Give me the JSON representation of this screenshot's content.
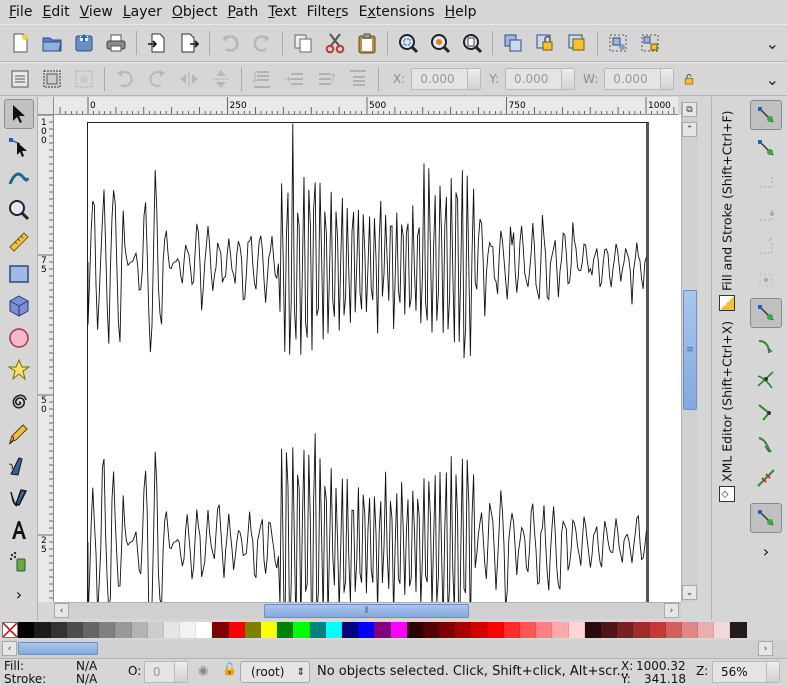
{
  "menu": [
    {
      "key": "file",
      "label": "File",
      "mnemonic": "F",
      "rest": "ile"
    },
    {
      "key": "edit",
      "label": "Edit",
      "mnemonic": "E",
      "rest": "dit"
    },
    {
      "key": "view",
      "label": "View",
      "mnemonic": "V",
      "rest": "iew"
    },
    {
      "key": "layer",
      "label": "Layer",
      "mnemonic": "L",
      "rest": "ayer"
    },
    {
      "key": "object",
      "label": "Object",
      "mnemonic": "O",
      "rest": "bject"
    },
    {
      "key": "path",
      "label": "Path",
      "mnemonic": "P",
      "rest": "ath"
    },
    {
      "key": "text",
      "label": "Text",
      "mnemonic": "T",
      "rest": "ext"
    },
    {
      "key": "filters",
      "label": "Filters",
      "mnemonic": "r",
      "pre": "Filte",
      "rest": "s"
    },
    {
      "key": "extensions",
      "label": "Extensions",
      "mnemonic": "x",
      "pre": "E",
      "rest": "tensions"
    },
    {
      "key": "help",
      "label": "Help",
      "mnemonic": "H",
      "rest": "elp"
    }
  ],
  "controls": {
    "x_label": "X:",
    "x_value": "0.000",
    "y_label": "Y:",
    "y_value": "0.000",
    "w_label": "W:",
    "w_value": "0.000"
  },
  "hruler": {
    "labels": [
      "0",
      "250",
      "500",
      "750",
      "1000"
    ]
  },
  "vruler": {
    "labels": [
      "100",
      "75",
      "50",
      "25"
    ]
  },
  "docks": {
    "fill_stroke": "Fill and Stroke (Shift+Ctrl+F)",
    "xml_editor": "XML Editor (Shift+Ctrl+X)"
  },
  "palette": [
    "#000000",
    "#1a1a1a",
    "#333333",
    "#4d4d4d",
    "#666666",
    "#808080",
    "#999999",
    "#b3b3b3",
    "#cccccc",
    "#e6e6e6",
    "#f2f2f2",
    "#ffffff",
    "#800000",
    "#ff0000",
    "#808000",
    "#ffff00",
    "#008000",
    "#00ff00",
    "#008080",
    "#00ffff",
    "#000080",
    "#0000ff",
    "#800080",
    "#ff00ff",
    "#2b0000",
    "#550000",
    "#800000",
    "#aa0000",
    "#d40000",
    "#ff0000",
    "#ff2a2a",
    "#ff5555",
    "#ff8080",
    "#ffaaaa",
    "#ffd5d5",
    "#280b0b",
    "#501616",
    "#782121",
    "#a02c2c",
    "#c83737",
    "#d35f5f",
    "#de8787",
    "#e9afaf",
    "#f4d7d7",
    "#241c1c"
  ],
  "status": {
    "fill_label": "Fill:",
    "fill_value": "N/A",
    "stroke_label": "Stroke:",
    "stroke_value": "N/A",
    "opacity_label": "O:",
    "opacity_value": "0",
    "layer": "(root)",
    "message": "No objects selected. Click, Shift+click, Alt+scr...",
    "x_label": "X:",
    "x_value": "1000.32",
    "y_label": "Y:",
    "y_value": "341.18",
    "zoom_label": "Z:",
    "zoom_value": "56%"
  }
}
